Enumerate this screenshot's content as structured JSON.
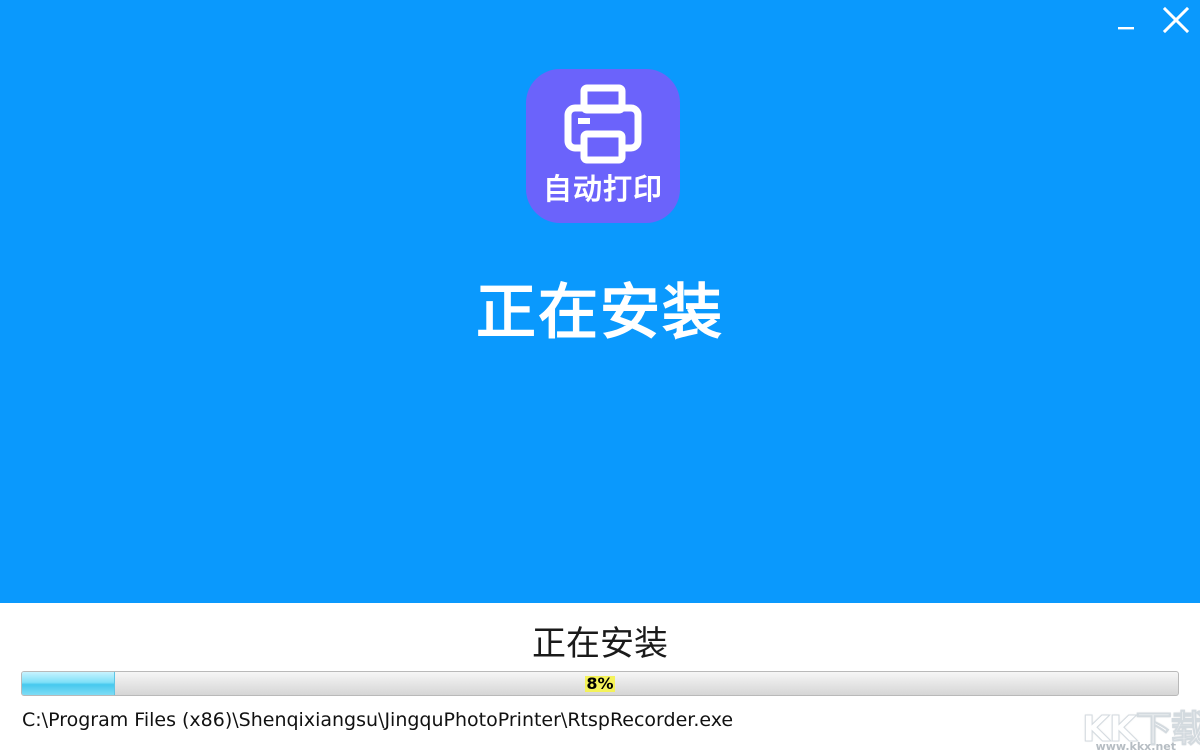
{
  "window": {
    "controls": {
      "minimize_icon": "minimize-icon",
      "close_icon": "close-icon"
    }
  },
  "hero": {
    "background_color": "#0a99fd",
    "app_icon": {
      "icon": "printer-icon",
      "background_color": "#6b63fb",
      "label": "自动打印"
    },
    "title": "正在安装"
  },
  "status": {
    "label": "正在安装",
    "progress": {
      "percent_value": 8,
      "percent_text": "8%"
    },
    "current_file": "C:\\Program Files (x86)\\Shenqixiangsu\\JingquPhotoPrinter\\RtspRecorder.exe"
  },
  "watermark": {
    "logo_text": "KK下载",
    "url": "www.kkx.net"
  }
}
